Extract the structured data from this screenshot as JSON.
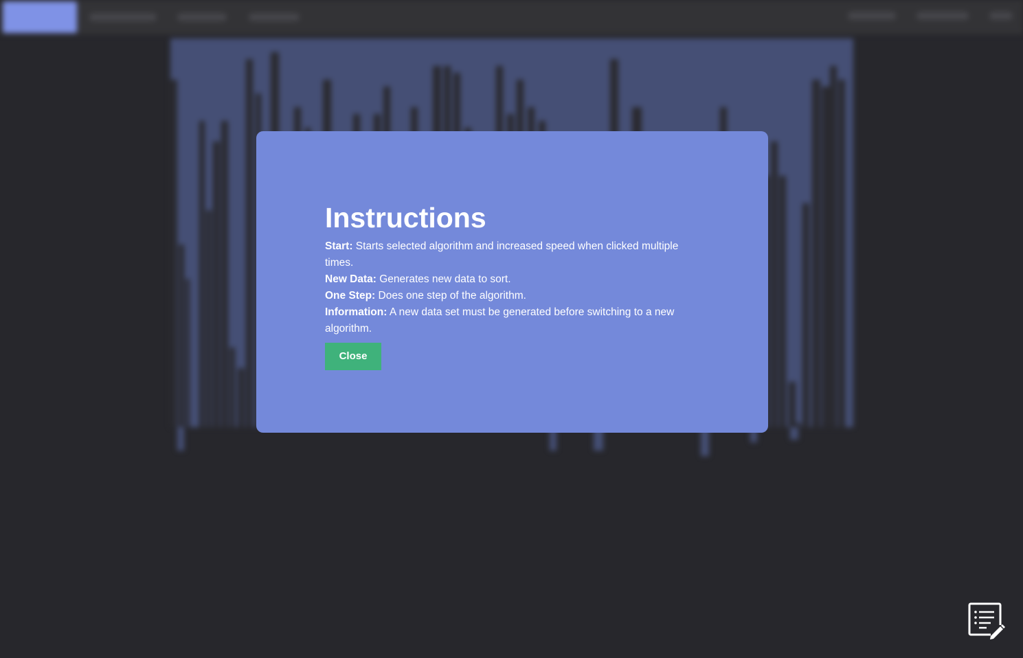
{
  "navbar": {
    "active_label": "",
    "items_left": [
      "",
      "",
      ""
    ],
    "items_right": [
      "",
      "",
      ""
    ]
  },
  "modal": {
    "title": "Instructions",
    "lines": [
      {
        "label": "Start:",
        "text": "Starts selected algorithm and increased speed when clicked multiple times."
      },
      {
        "label": "New Data:",
        "text": "Generates new data to sort."
      },
      {
        "label": "One Step:",
        "text": "Does one step of the algorithm."
      },
      {
        "label": "Information:",
        "text": "A new data set must be generated before switching to a new algorithm."
      }
    ],
    "close_label": "Close"
  },
  "colors": {
    "background": "#27272c",
    "modal": "#7489da",
    "close_button": "#3fb27b",
    "nav_active": "#7f92e6",
    "visualization": "#454f75"
  },
  "icons": {
    "notes": "notes-edit-icon"
  }
}
